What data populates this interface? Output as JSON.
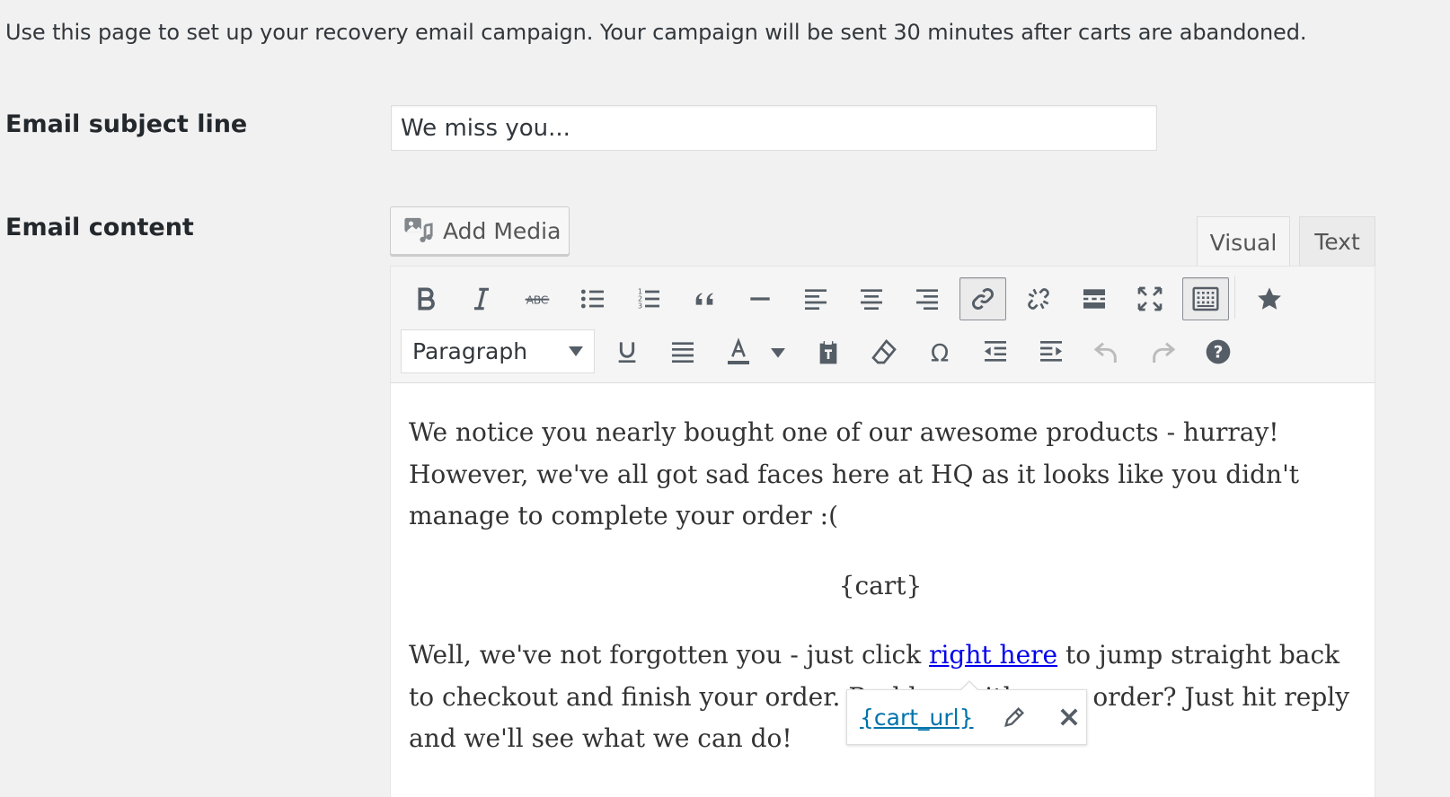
{
  "intro_text": "Use this page to set up your recovery email campaign. Your campaign will be sent 30 minutes after carts are abandoned.",
  "subject": {
    "label": "Email subject line",
    "value": "We miss you..."
  },
  "content_field": {
    "label": "Email content",
    "add_media_label": "Add Media",
    "tabs": {
      "visual": "Visual",
      "text": "Text",
      "active": "visual"
    }
  },
  "toolbar": {
    "row1_icons": [
      "bold-icon",
      "italic-icon",
      "strikethrough-icon",
      "bulleted-list-icon",
      "numbered-list-icon",
      "blockquote-icon",
      "horizontal-line-icon",
      "align-left-icon",
      "align-center-icon",
      "align-right-icon",
      "insert-link-icon",
      "remove-link-icon",
      "read-more-icon",
      "fullscreen-icon",
      "toolbar-toggle-icon",
      "star-icon"
    ],
    "format_select_value": "Paragraph",
    "row2_icons": [
      "underline-icon",
      "justify-icon",
      "text-color-icon",
      "paste-as-text-icon",
      "clear-formatting-icon",
      "special-character-icon",
      "outdent-icon",
      "indent-icon",
      "undo-icon",
      "redo-icon",
      "help-icon"
    ]
  },
  "body": {
    "p1": "We notice you nearly bought one of our awesome products - hurray! However, we've all got sad faces here at HQ as it looks like you didn't manage to complete your order :(",
    "cart_placeholder": "{cart}",
    "p3_before": "Well, we've not forgotten you - just click ",
    "p3_link": "right here",
    "p3_after": " to jump straight back to checkout and finish your order. Problem with your order? Just hit reply and we'll see what we can do!"
  },
  "link_popup": {
    "url": "{cart_url}"
  },
  "colors": {
    "background": "#f1f1f1",
    "link": "#0000ee",
    "popup_link": "#0073aa",
    "icon": "#555d66"
  }
}
